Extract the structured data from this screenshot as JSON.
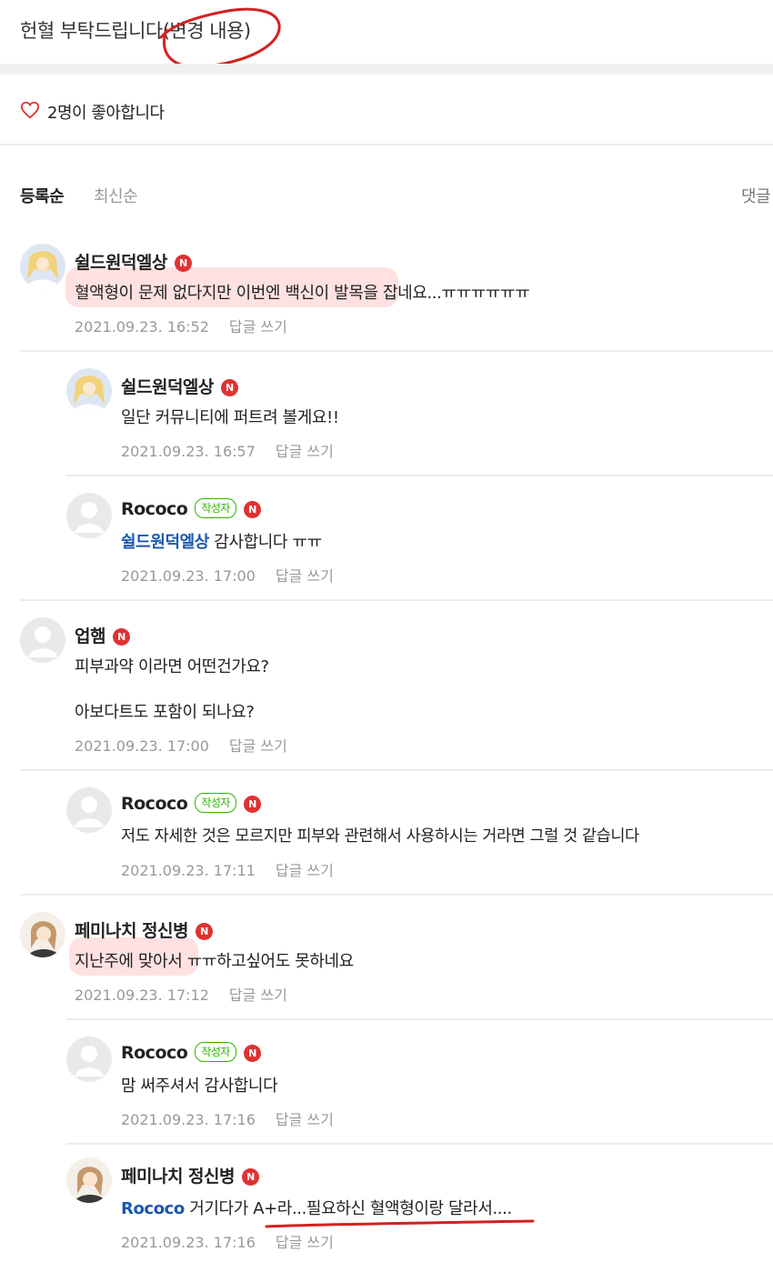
{
  "post": {
    "title": "헌혈 부탁드립니다(변경 내용)"
  },
  "likes": {
    "text": "2명이 좋아합니다"
  },
  "sort": {
    "registered": "등록순",
    "newest": "최신순",
    "right_label": "댓글"
  },
  "labels": {
    "reply": "답글 쓰기",
    "author_badge": "작성자",
    "n_badge": "N"
  },
  "comments": [
    {
      "nick": "쉴드원덕엘상",
      "mention": "",
      "text": "혈액형이 문제 없다지만 이번엔 백신이 발목을 잡네요...ㅠㅠㅠㅠㅠㅠ",
      "time": "2021.09.23. 16:52"
    },
    {
      "nick": "쉴드원덕엘상",
      "mention": "",
      "text": "일단 커뮤니티에 퍼트려 볼게요!!",
      "time": "2021.09.23. 16:57"
    },
    {
      "nick": "Rococo",
      "mention": "쉴드원덕엘상",
      "text": "감사합니다 ㅠㅠ",
      "time": "2021.09.23. 17:00"
    },
    {
      "nick": "업햄",
      "mention": "",
      "text": "피부과약 이라면 어떤건가요?",
      "text2": "아보다트도 포함이 되나요?",
      "time": "2021.09.23. 17:00"
    },
    {
      "nick": "Rococo",
      "mention": "",
      "text": "저도 자세한 것은 모르지만 피부와 관련해서 사용하시는 거라면 그럴 것 같습니다",
      "time": "2021.09.23. 17:11"
    },
    {
      "nick": "페미나치 정신병",
      "mention": "",
      "text": "지난주에 맞아서 ㅠㅠ하고싶어도 못하네요",
      "time": "2021.09.23. 17:12"
    },
    {
      "nick": "Rococo",
      "mention": "",
      "text": "맘 써주셔서 감사합니다",
      "time": "2021.09.23. 17:16"
    },
    {
      "nick": "페미나치 정신병",
      "mention": "Rococo",
      "text": "거기다가 A+라...필요하신 혈액형이랑 달라서....",
      "time": "2021.09.23. 17:16"
    }
  ],
  "colors": {
    "mention": "#1a57b0",
    "author_badge": "#2db400",
    "n_badge": "#e03131",
    "annotation_red": "#d42020"
  }
}
